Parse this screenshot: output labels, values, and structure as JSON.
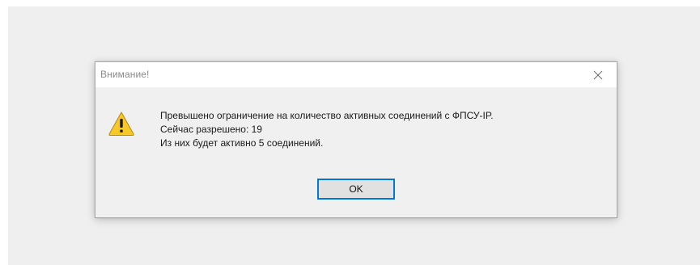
{
  "dialog": {
    "title": "Внимание!",
    "close_icon": "close-icon",
    "warning_icon": "warning-icon",
    "message_lines": [
      "Превышено ограничение на количество активных соединений с ФПСУ-IP.",
      "Сейчас разрешено: 19",
      "Из них будет активно 5 соединений."
    ],
    "ok_label": "OK"
  },
  "colors": {
    "accent": "#0078d7",
    "warning_fill": "#f7c928",
    "background": "#efefef"
  }
}
